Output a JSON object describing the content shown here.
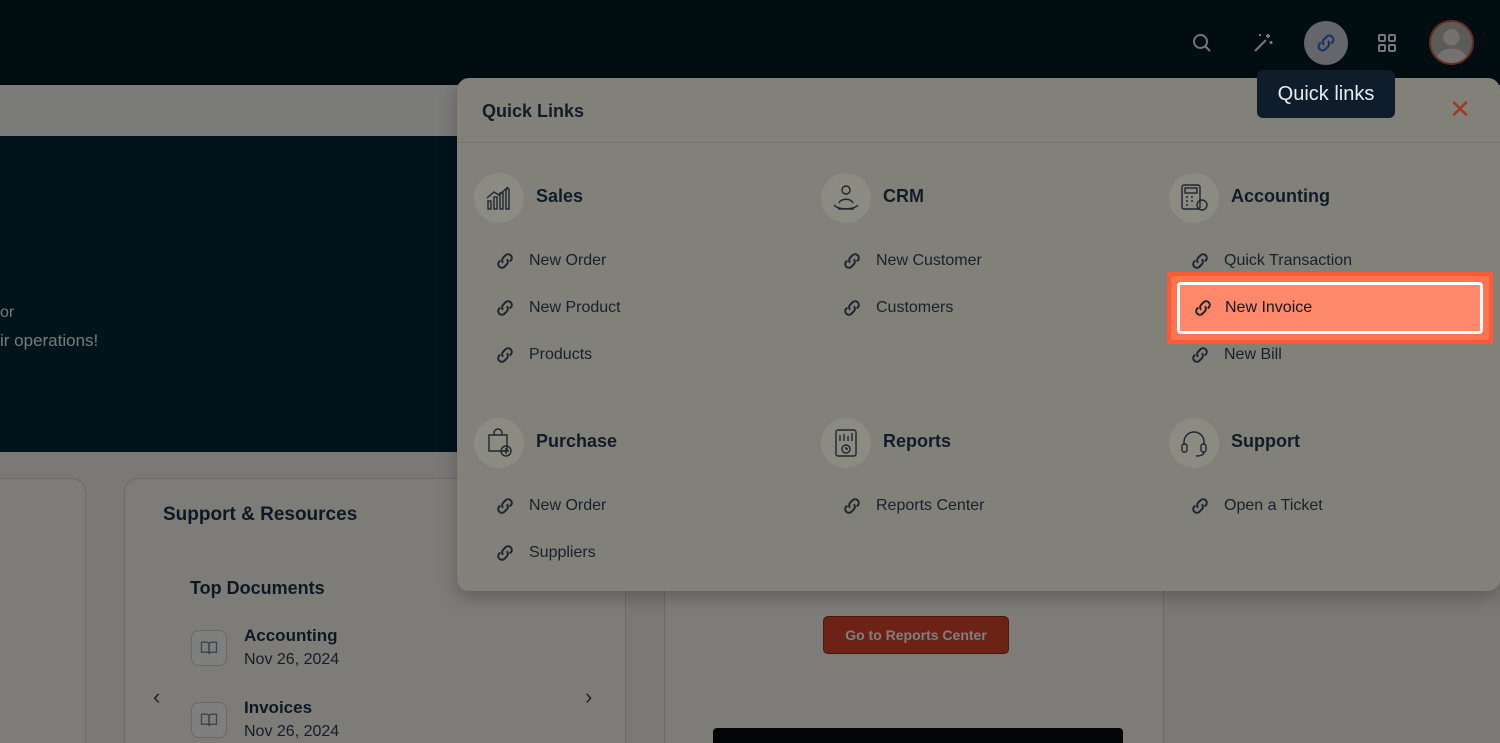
{
  "topbar": {
    "icons": [
      "search-icon",
      "magic-wand-icon",
      "link-icon",
      "grid-icon",
      "avatar"
    ],
    "tooltip": "Quick links"
  },
  "hero": {
    "line1": "or",
    "line2": "ir operations!"
  },
  "support": {
    "title": "Support & Resources",
    "top_documents_title": "Top Documents",
    "documents": [
      {
        "name": "Accounting",
        "date": "Nov 26, 2024"
      },
      {
        "name": "Invoices",
        "date": "Nov 26, 2024"
      }
    ]
  },
  "reports_card": {
    "button_label": "Go to Reports Center"
  },
  "quick_links": {
    "title": "Quick Links",
    "close_icon": "close-icon",
    "highlight_color": "#ff5a36",
    "sections": [
      {
        "title": "Sales",
        "icon": "sales-chart-icon",
        "links": [
          "New Order",
          "New Product",
          "Products"
        ]
      },
      {
        "title": "CRM",
        "icon": "crm-handshake-icon",
        "links": [
          "New Customer",
          "Customers"
        ]
      },
      {
        "title": "Accounting",
        "icon": "accounting-calculator-icon",
        "links": [
          "Quick Transaction",
          "New Invoice",
          "New Bill"
        ]
      },
      {
        "title": "Purchase",
        "icon": "purchase-bag-icon",
        "links": [
          "New Order",
          "Suppliers"
        ]
      },
      {
        "title": "Reports",
        "icon": "reports-clipboard-icon",
        "links": [
          "Reports Center"
        ]
      },
      {
        "title": "Support",
        "icon": "support-headset-icon",
        "links": [
          "Open a Ticket"
        ]
      }
    ]
  }
}
